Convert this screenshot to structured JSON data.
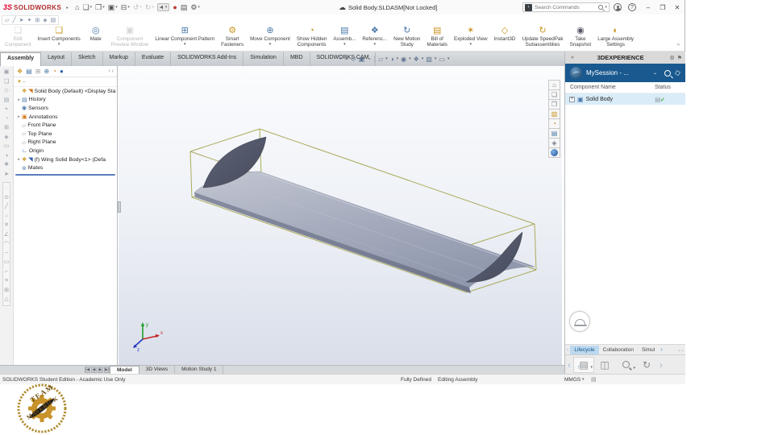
{
  "titlebar": {
    "logo_mark": "3S",
    "logo": "SOLIDWORKS",
    "doc_title": "Solid Body.SLDASM[Not Locked]",
    "search_placeholder": "Search Commands"
  },
  "icons": {
    "home": "⌂",
    "new_doc": "❏",
    "open": "❐",
    "save": "▣",
    "print": "⊟",
    "undo": "↺",
    "redo": "↻",
    "select": "➤",
    "rebuild": "●",
    "bom": "▤",
    "options": "⚙",
    "caret": "▾",
    "expander": "▸",
    "chevron_down": "⌄",
    "chevron_left": "‹",
    "chevron_right": "›",
    "collapse": "«",
    "pin": "⚑",
    "gear": "⚙",
    "help": "?",
    "minimize": "–",
    "restore": "❐",
    "close": "✕",
    "cloud": "☁",
    "plus": "+",
    "check": "✓",
    "funnel": "▼",
    "up": "↑",
    "collapse_up": "^",
    "badge_arrow": "›",
    "tag": "◇",
    "server": "▤",
    "sync": "↻"
  },
  "subbar": [
    "▱",
    "╱",
    "➤",
    "✦",
    "⊞",
    "◈",
    "▤"
  ],
  "ribbon": {
    "buttons": [
      {
        "label": "Edit\nComponent",
        "glyph": "❏"
      },
      {
        "label": "Insert Components",
        "glyph": "❏"
      },
      {
        "label": "Mate",
        "glyph": "◎"
      },
      {
        "label": "Component\nPreview Window",
        "glyph": "▣"
      },
      {
        "label": "Linear Component Pattern",
        "glyph": "⊞"
      },
      {
        "label": "Smart\nFasteners",
        "glyph": "⚙"
      },
      {
        "label": "Move Component",
        "glyph": "⊕"
      },
      {
        "label": "Show Hidden\nComponents",
        "glyph": "◔"
      },
      {
        "label": "Assemb...",
        "glyph": "▤"
      },
      {
        "label": "Referenc...",
        "glyph": "❖"
      },
      {
        "label": "New Motion\nStudy",
        "glyph": "↻"
      },
      {
        "label": "Bill of\nMaterials",
        "glyph": "▤"
      },
      {
        "label": "Exploded View",
        "glyph": "✶"
      },
      {
        "label": "Instant3D",
        "glyph": "◇"
      },
      {
        "label": "Update SpeedPak\nSubassemblies",
        "glyph": "↻"
      },
      {
        "label": "Take\nSnapshot",
        "glyph": "◉"
      },
      {
        "label": "Large Assembly\nSettings",
        "glyph": "◐"
      }
    ]
  },
  "command_tabs": {
    "active": "Assembly",
    "items": [
      "Assembly",
      "Layout",
      "Sketch",
      "Markup",
      "Evaluate",
      "SOLIDWORKS Add-Ins",
      "Simulation",
      "MBD",
      "SOLIDWORKS CAM"
    ]
  },
  "hud": [
    "⌖",
    "⌗",
    "↺",
    "▣",
    "◔",
    "▱",
    "◑",
    "◉",
    "❖",
    "▨",
    "▭"
  ],
  "lt_top": [
    "▣",
    "❏",
    "◇",
    "▤",
    "⌖",
    "◔",
    "⊞",
    "◈",
    "▭",
    "◑",
    "❖",
    "➤"
  ],
  "lt_bot": [
    "∙",
    "⊙",
    "╱",
    "○",
    "✕",
    "∠",
    "◠",
    "~",
    "▭",
    "⌐",
    "≡",
    "⊞",
    "△"
  ],
  "feature_tree": {
    "items": [
      {
        "label": "Solid Body (Default) <Display Sta",
        "glyph": "❖",
        "glyph2": "◥",
        "expand": ""
      },
      {
        "label": "History",
        "glyph": "▤",
        "expand": "▸"
      },
      {
        "label": "Sensors",
        "glyph": "◉",
        "expand": ""
      },
      {
        "label": "Annotations",
        "glyph": "▣",
        "expand": "▸"
      },
      {
        "label": "Front Plane",
        "glyph": "▱",
        "expand": ""
      },
      {
        "label": "Top Plane",
        "glyph": "▱",
        "expand": ""
      },
      {
        "label": "Right Plane",
        "glyph": "▱",
        "expand": ""
      },
      {
        "label": "Origin",
        "glyph": "∟",
        "expand": ""
      },
      {
        "label": "(f) Wing Solid Body<1> (Defa",
        "glyph": "❖",
        "glyph2": "◥",
        "expand": "▸"
      },
      {
        "label": "Mates",
        "glyph": "⊚",
        "expand": ""
      }
    ]
  },
  "vtools": [
    "⌂",
    "❏",
    "❐",
    "▨",
    "◔",
    "▤",
    "◈"
  ],
  "viewport": {
    "triad": {
      "x": "x",
      "y": "y",
      "z": "z"
    }
  },
  "right_panel": {
    "title": "3DEXPERIENCE",
    "session": "MySession - ...",
    "columns": [
      "Component Name",
      "Status"
    ],
    "rows": [
      {
        "name": "Solid Body"
      }
    ],
    "tabs": {
      "active": "Lifecycle",
      "items": [
        "Lifecycle",
        "Collaboration",
        "Simul"
      ]
    },
    "ptool_glyphs": [
      "▤",
      "◫",
      "↻"
    ]
  },
  "bottom_tabs": {
    "active": "Model",
    "items": [
      "Model",
      "3D Views",
      "Motion Study 1"
    ]
  },
  "statusbar": {
    "left": "SOLIDWORKS Student Edition - Academic Use Only",
    "defined": "Fully Defined",
    "mode": "Editing Assembly",
    "units": "MMGS"
  },
  "stamp": {
    "line1": "TEAM",
    "line2": "MAVERICK"
  },
  "colors": {
    "brand_red": "#e4002b",
    "accent_blue": "#19598f",
    "selection": "#d9ecf8",
    "box_wire": "#a8a851",
    "wing_gray": "#9aa1b5",
    "fin_dark": "#50556a",
    "status_green": "#3fa535"
  }
}
